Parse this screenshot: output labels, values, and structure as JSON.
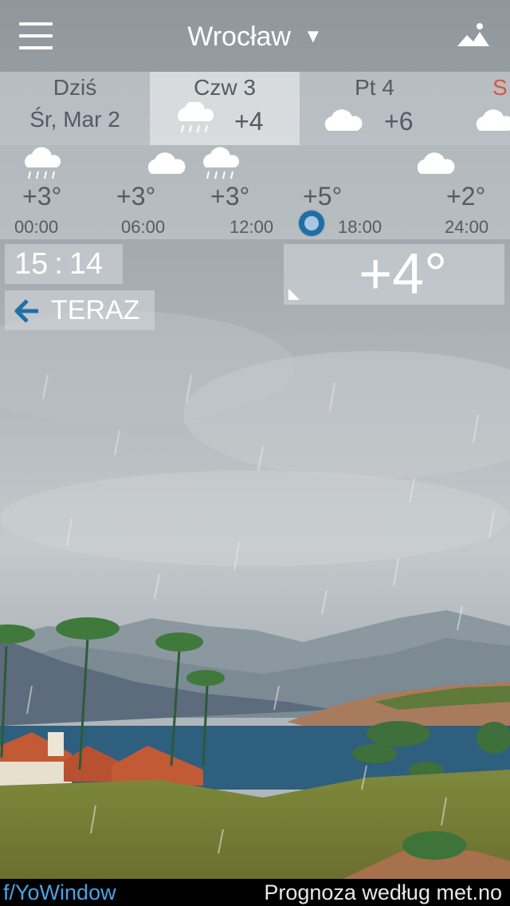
{
  "header": {
    "city": "Wrocław",
    "city_arrow": "▼",
    "menu_icon": "hamburger-menu-icon",
    "landscape_icon": "landscape-icon"
  },
  "days": [
    {
      "line1": "Dziś",
      "line2": "Śr, Mar 2",
      "selected": false
    },
    {
      "line1": "Czw 3",
      "temp": "+4",
      "icon": "rain-cloud-icon",
      "selected": true
    },
    {
      "line1": "Pt 4",
      "temp": "+6",
      "icon": "cloud-icon",
      "selected": false
    },
    {
      "line1": "S",
      "icon": "cloud-icon",
      "color": "#e2533b",
      "selected": false
    }
  ],
  "hourly": [
    {
      "time": "00:00",
      "temp": "+3°",
      "icon": "rain-cloud-icon"
    },
    {
      "time": "06:00",
      "temp": "+3°",
      "icon": "cloud-icon"
    },
    {
      "time": "12:00",
      "temp": "+3°",
      "icon": "rain-cloud-icon"
    },
    {
      "time": "18:00",
      "temp": "+5°",
      "icon": "none"
    },
    {
      "time": "24:00",
      "temp": "+2°",
      "icon": "cloud-icon"
    }
  ],
  "current": {
    "time_hh": "15",
    "time_sep": ":",
    "time_mm": "14",
    "now_label": "TERAZ",
    "temperature": "+4°"
  },
  "footer": {
    "brand": "f/YoWindow",
    "provider": "Prognoza według met.no"
  },
  "colors": {
    "accent_blue": "#1f6ea8",
    "brand_link": "#4aa3e6",
    "weekend_red": "#e2533b"
  }
}
